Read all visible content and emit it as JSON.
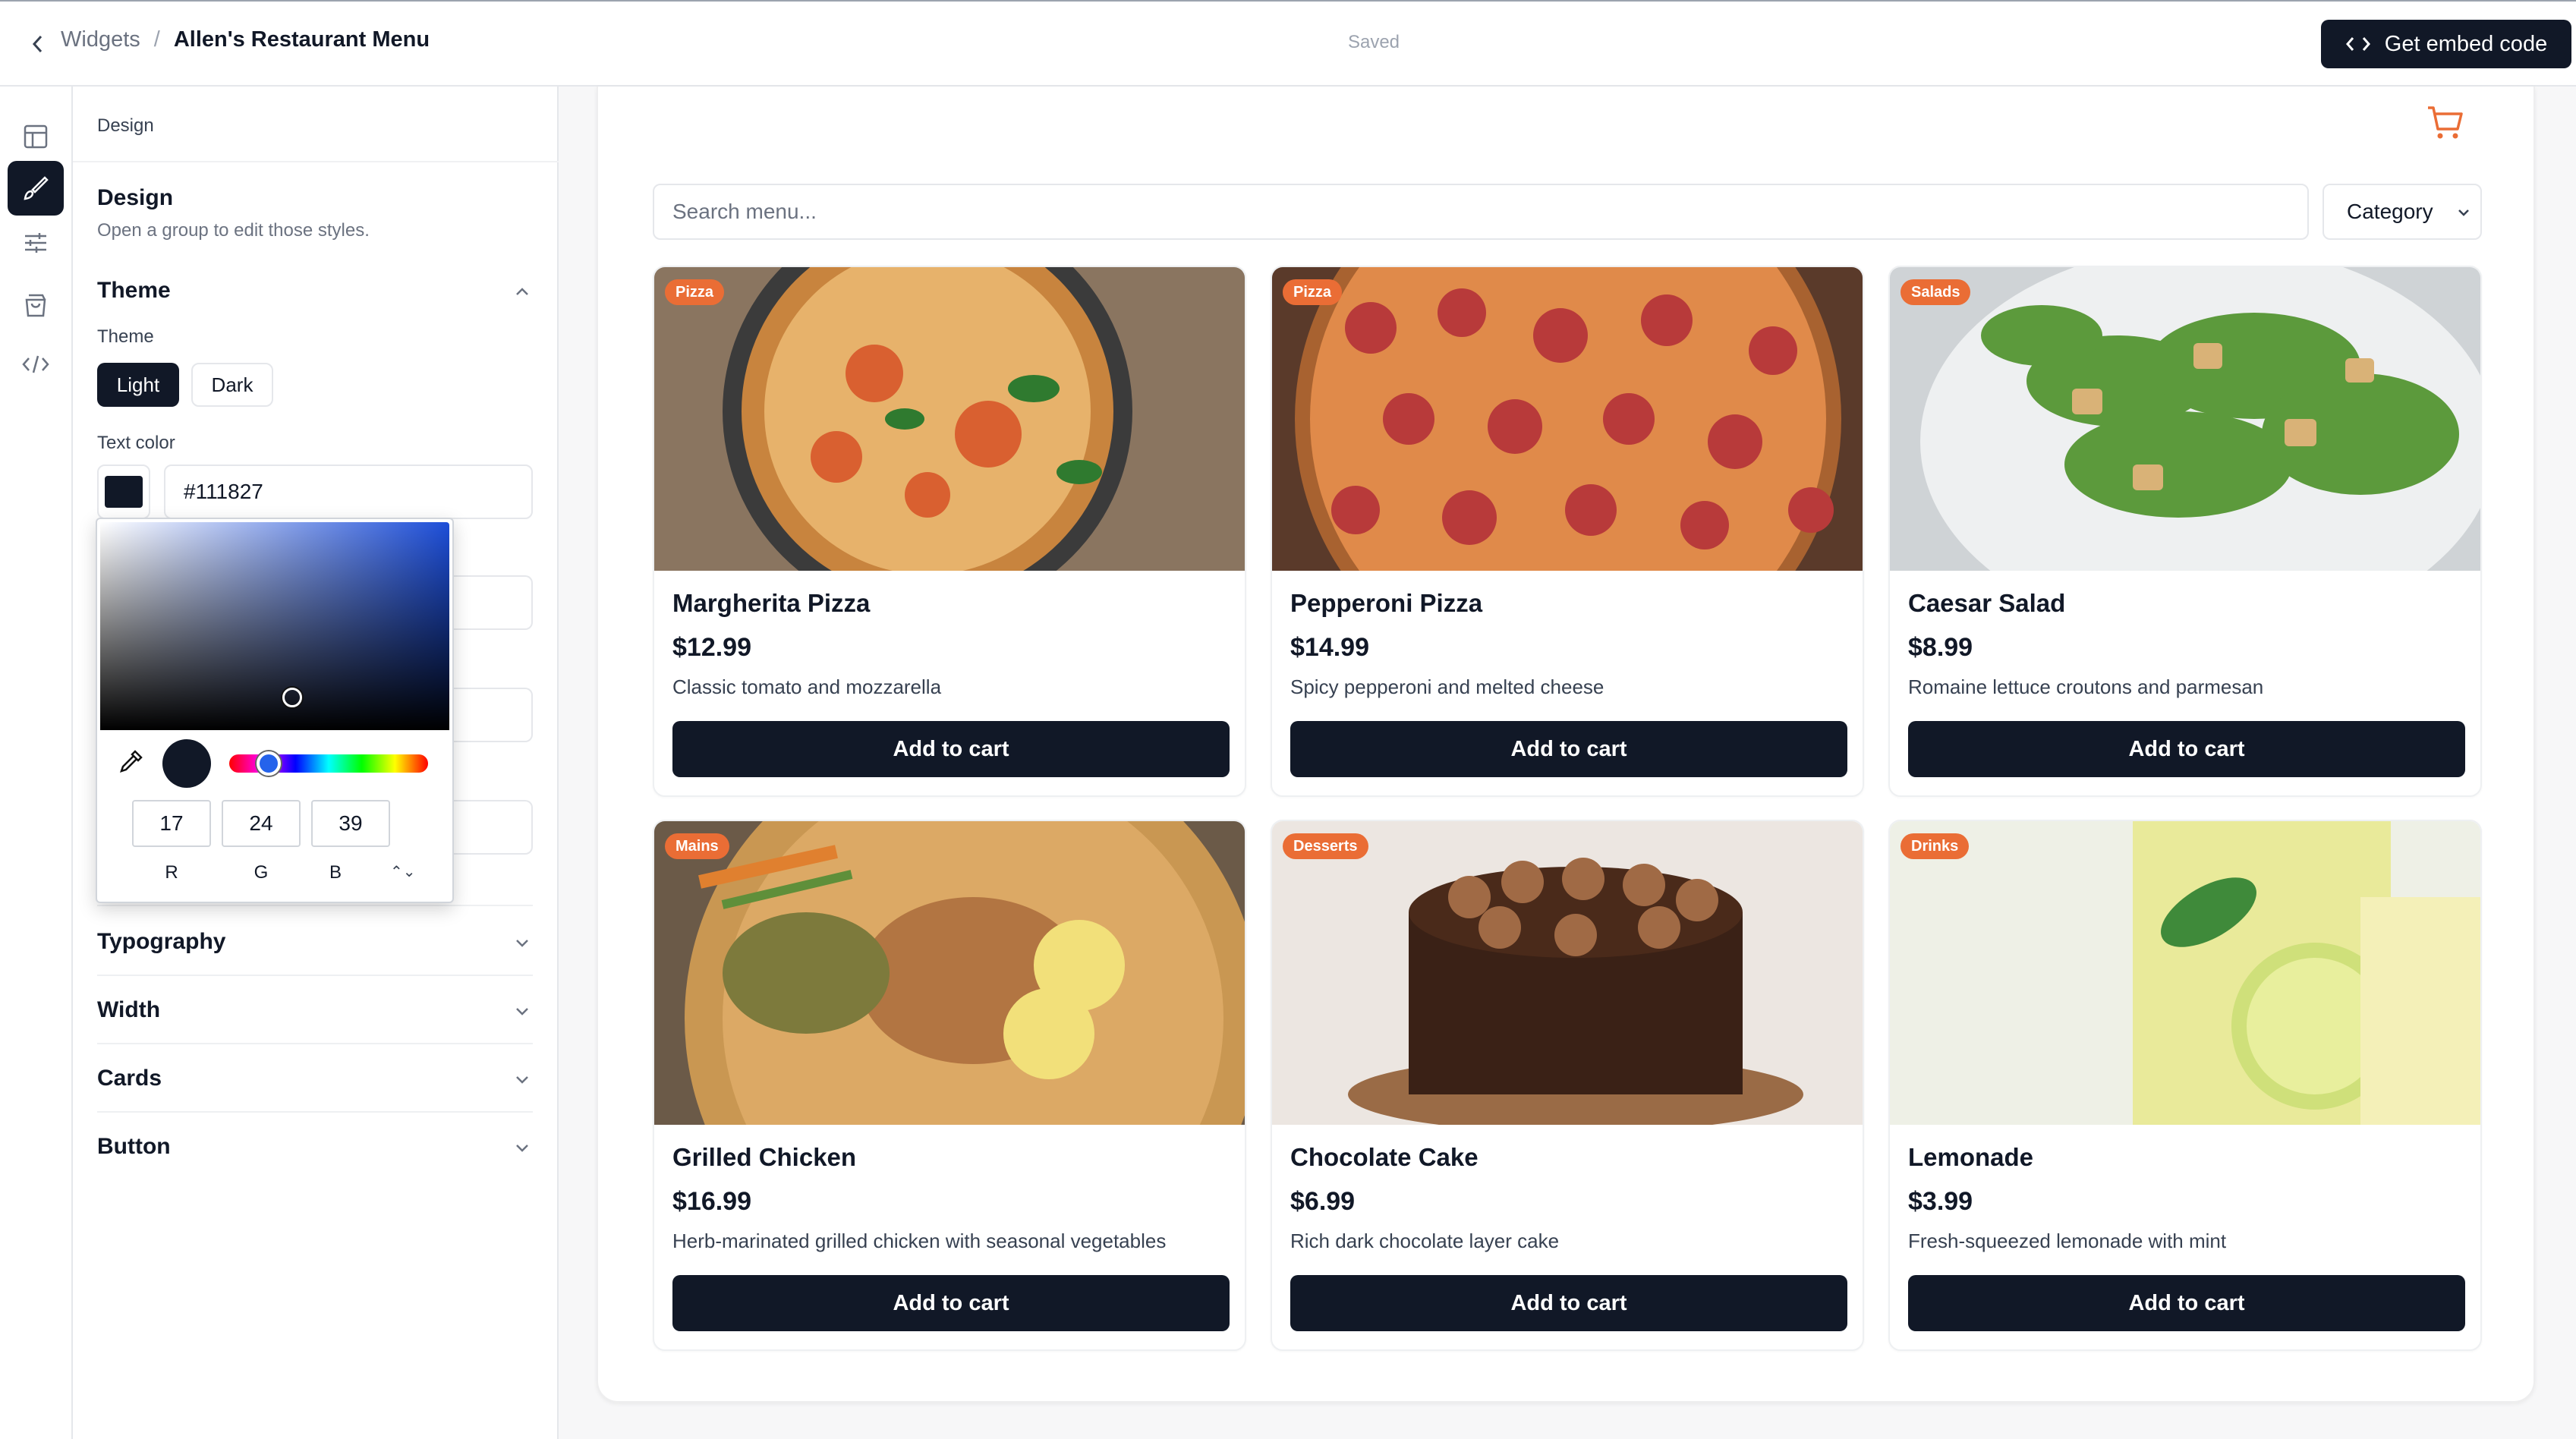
{
  "header": {
    "breadcrumb_parent": "Widgets",
    "breadcrumb_separator": "/",
    "breadcrumb_current": "Allen's Restaurant Menu",
    "status": "Saved",
    "embed_button": "Get embed code"
  },
  "rail": {
    "items": [
      "layout-icon",
      "brush-icon",
      "sliders-icon",
      "shopping-bag-icon",
      "code-icon"
    ],
    "active": "brush-icon"
  },
  "panel": {
    "header": "Design",
    "title": "Design",
    "subtitle": "Open a group to edit those styles.",
    "theme_group": "Theme",
    "theme_label": "Theme",
    "theme_options": [
      "Light",
      "Dark"
    ],
    "theme_selected": "Light",
    "text_color_label": "Text color",
    "text_color_value": "#111827",
    "picker": {
      "r": "17",
      "g": "24",
      "b": "39",
      "r_label": "R",
      "g_label": "G",
      "b_label": "B",
      "mode_toggle": "⌃⌄"
    },
    "groups": [
      "Typography",
      "Width",
      "Cards",
      "Button"
    ]
  },
  "widget": {
    "search_placeholder": "Search menu...",
    "category_label": "Category",
    "add_label": "Add to cart",
    "items": [
      {
        "badge": "Pizza",
        "name": "Margherita Pizza",
        "price": "$12.99",
        "desc": "Classic tomato and mozzarella"
      },
      {
        "badge": "Pizza",
        "name": "Pepperoni Pizza",
        "price": "$14.99",
        "desc": "Spicy pepperoni and melted cheese"
      },
      {
        "badge": "Salads",
        "name": "Caesar Salad",
        "price": "$8.99",
        "desc": "Romaine lettuce croutons and parmesan"
      },
      {
        "badge": "Mains",
        "name": "Grilled Chicken",
        "price": "$16.99",
        "desc": "Herb-marinated grilled chicken with seasonal vegetables"
      },
      {
        "badge": "Desserts",
        "name": "Chocolate Cake",
        "price": "$6.99",
        "desc": "Rich dark chocolate layer cake"
      },
      {
        "badge": "Drinks",
        "name": "Lemonade",
        "price": "$3.99",
        "desc": "Fresh-squeezed lemonade with mint"
      }
    ]
  },
  "colors": {
    "primary": "#111827",
    "badge": "#ea6d35",
    "cart_icon": "#ea6d35"
  }
}
